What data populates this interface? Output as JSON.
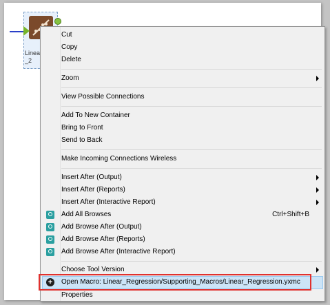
{
  "canvas": {
    "tool": {
      "label_line1": "Linear",
      "label_line2": "_2"
    }
  },
  "menu": {
    "items": {
      "cut": "Cut",
      "copy": "Copy",
      "delete": "Delete",
      "zoom": "Zoom",
      "view_connections": "View Possible Connections",
      "add_container": "Add To New Container",
      "bring_front": "Bring to Front",
      "send_back": "Send to Back",
      "wireless": "Make Incoming Connections Wireless",
      "insert_output": "Insert After (Output)",
      "insert_reports": "Insert After (Reports)",
      "insert_interactive": "Insert After (Interactive Report)",
      "add_all_browses": "Add All Browses",
      "add_all_browses_shortcut": "Ctrl+Shift+B",
      "browse_output": "Add Browse After (Output)",
      "browse_reports": "Add Browse After (Reports)",
      "browse_interactive": "Add Browse After (Interactive Report)",
      "choose_version": "Choose Tool Version",
      "open_macro": "Open Macro: Linear_Regression/Supporting_Macros/Linear_Regression.yxmc",
      "properties": "Properties"
    },
    "icons": {
      "browse": "browse-icon",
      "open": "plus-circle-icon"
    },
    "colors": {
      "highlight": "#cce4f7",
      "annotation": "#e0312e"
    }
  }
}
